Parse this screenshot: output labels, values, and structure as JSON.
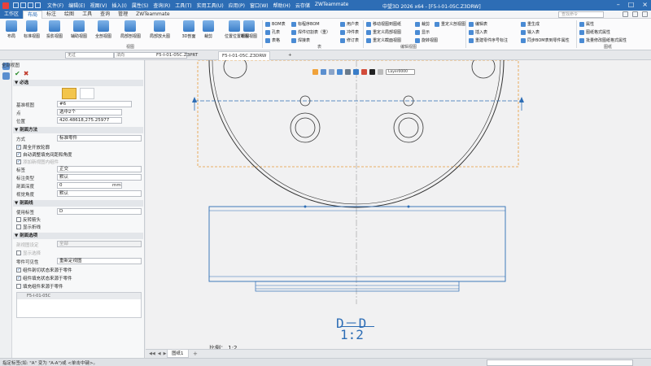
{
  "titlebar": {
    "menus": [
      "文件(F)",
      "编辑(E)",
      "视图(V)",
      "插入(I)",
      "属性(S)",
      "查询(R)",
      "工具(T)",
      "实用工具(U)",
      "应用(P)",
      "窗口(W)",
      "帮助(H)",
      "云存储",
      "ZWTeammate"
    ],
    "title": "中望3D 2026 x64 - [F5-I-01-05C.Z3DRW]"
  },
  "ribbon_tabs": [
    "工作区",
    "布局",
    "标注",
    "绘图",
    "工具",
    "查询",
    "管理",
    "ZWTeammate"
  ],
  "ribbon_active_tab": "布局",
  "search_placeholder": "查找命令",
  "ribbon": {
    "view_group": {
      "label": "视图",
      "buttons": [
        "布局",
        "标准视图",
        "投影视图",
        "辅助视图",
        "全剖视图",
        "局部剖视图",
        "局部放大图",
        "3D剖面",
        "裁剪",
        "位置位置视图",
        "断裂视图"
      ]
    },
    "table_group": {
      "label": "表",
      "items": [
        "BOM表",
        "孔表",
        "表格",
        "标程序BOM",
        "焊件切割表（重）",
        "焊接表",
        "用户表",
        "冲件表",
        "修订表"
      ]
    },
    "edit_view_group": {
      "label": "编辑视图",
      "items": [
        "移动视图到图纸",
        "重定义局部视图",
        "重定义截面视图",
        "裁剪",
        "显示",
        "旋转视图",
        "重定义剖视图",
        "编辑视图",
        "刷新"
      ]
    },
    "edit_group": {
      "label": "编辑视图",
      "items": [
        "编辑表",
        "插入表",
        "重建零件序号标注"
      ]
    },
    "gen_group": {
      "label": "图纸",
      "items": [
        "重生成",
        "输入表",
        "同步BOM表到零件属性",
        "属性",
        "图纸格式属性",
        "批量修改图纸格式属性"
      ]
    }
  },
  "doc_tabs": {
    "filter1": "无过",
    "filter2": "法向",
    "tabs": [
      "F5-I-01-05C.Z3PRT",
      "F5-I-01-05C.Z3DRW"
    ],
    "active": 1
  },
  "panel": {
    "title": "全剖视图",
    "required": "必选",
    "base_view_label": "基准视图",
    "base_view_value": "#6",
    "point_label": "点",
    "point_value": "选中2个",
    "position_label": "位置",
    "position_value": "420.48618,275.25977",
    "section_method": "剖面方法",
    "mode_label": "方式",
    "mode_value": "标准零件",
    "chk_all_sections": "周全开放轮廓",
    "chk_auto_adjust": "自动调整填充间距和角度",
    "chk_related": "添加新视图内组件",
    "label_label": "标签",
    "label_value": "正交",
    "style_label": "标注类型",
    "style_value": "默认",
    "depth_label": "剖面深度",
    "depth_value": "0",
    "depth_unit": "mm",
    "angle_label": "视觉角度",
    "angle_value": "默认",
    "section_line": "剖面线",
    "use_label": "使用标签",
    "use_label_value": "D",
    "chk_reverse": "反转箭头",
    "chk_show_line": "显示折线",
    "section_opts": "剖面选项",
    "component_label": "剖视图设定",
    "component_value": "全部",
    "chk_simplify": "显示选择",
    "part_visibility": "零件可见性",
    "part_visibility_value": "重新定视图",
    "chk_part_section": "组件剖切状态来源于零件",
    "chk_part_hatch": "组件填充状态来源于零件",
    "chk_hide_pass": "填充组件来源于零件",
    "list_item": "F5-I-01-05C"
  },
  "canvas": {
    "layer": "Layer0000",
    "section_title": "D－D",
    "section_scale": "1:2",
    "scale_label": "比例：",
    "scale_value": "1:2"
  },
  "sheet_tabs": [
    "图纸1"
  ],
  "status": "指定标签(如: \"A\" 变为 \"A-A\")或 <单击中键>。",
  "colors": {
    "accent": "#2d6db5",
    "drawing_blue": "#2d6db5",
    "dashed_orange": "#e69a3a"
  }
}
